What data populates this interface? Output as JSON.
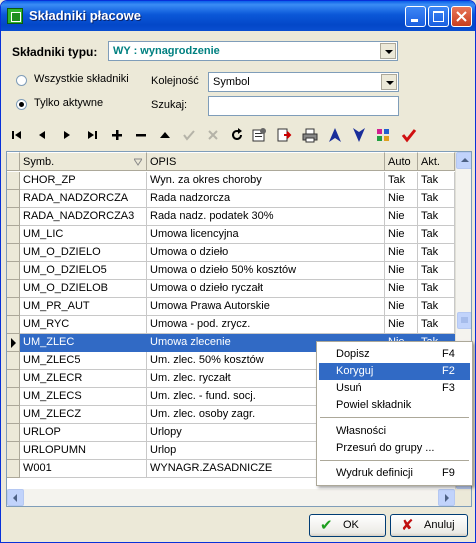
{
  "window": {
    "title": "Składniki płacowe"
  },
  "filters": {
    "type_label": "Składniki typu:",
    "type_value": "WY : wynagrodzenie",
    "radio_all": "Wszystkie składniki",
    "radio_active": "Tylko aktywne",
    "radio_selected": "active",
    "order_label": "Kolejność",
    "order_value": "Symbol",
    "search_label": "Szukaj:",
    "search_value": ""
  },
  "toolbar": {
    "icons": [
      "first-record-icon",
      "prev-record-icon",
      "next-record-icon",
      "last-record-icon",
      "add-icon",
      "delete-icon",
      "edit-icon",
      "confirm-icon",
      "cancel-icon",
      "refresh-icon",
      "properties-icon",
      "export-icon",
      "print-icon",
      "sort-asc-icon",
      "sort-desc-icon",
      "tools-icon",
      "check-icon"
    ]
  },
  "grid": {
    "columns": [
      "Symb.",
      "OPIS",
      "Auto",
      "Akt."
    ],
    "selected_row": 10,
    "rows": [
      [
        "CHOR_ZP",
        "Wyn. za okres choroby",
        "Tak",
        "Tak"
      ],
      [
        "RADA_NADZORCZA",
        "Rada nadzorcza",
        "Nie",
        "Tak"
      ],
      [
        "RADA_NADZORCZA3",
        "Rada nadz. podatek 30%",
        "Nie",
        "Tak"
      ],
      [
        "UM_LIC",
        "Umowa licencyjna",
        "Nie",
        "Tak"
      ],
      [
        "UM_O_DZIELO",
        "Umowa o dzieło",
        "Nie",
        "Tak"
      ],
      [
        "UM_O_DZIELO5",
        "Umowa o dzieło 50% kosztów",
        "Nie",
        "Tak"
      ],
      [
        "UM_O_DZIELOB",
        "Umowa o dzieło ryczałt",
        "Nie",
        "Tak"
      ],
      [
        "UM_PR_AUT",
        "Umowa Prawa Autorskie",
        "Nie",
        "Tak"
      ],
      [
        "UM_RYC",
        "Umowa - pod. zrycz.",
        "Nie",
        "Tak"
      ],
      [
        "UM_ZLEC",
        "Umowa zlecenie",
        "Nie",
        "Tak"
      ],
      [
        "UM_ZLEC5",
        "Um. zlec. 50% kosztów",
        "",
        ""
      ],
      [
        "UM_ZLECR",
        " Um. zlec. ryczałt",
        "",
        ""
      ],
      [
        "UM_ZLECS",
        " Um. zlec. - fund. socj.",
        "",
        ""
      ],
      [
        "UM_ZLECZ",
        " Um. zlec. osoby zagr.",
        "",
        ""
      ],
      [
        "URLOP",
        "Urlopy",
        "",
        ""
      ],
      [
        "URLOPUMN",
        "Urlop",
        "",
        ""
      ],
      [
        "W001",
        "WYNAGR.ZASADNICZE",
        "",
        ""
      ]
    ]
  },
  "context_menu": {
    "items": [
      {
        "label": "Dopisz",
        "key": "F4"
      },
      {
        "label": "Koryguj",
        "key": "F2"
      },
      {
        "label": "Usuń",
        "key": "F3"
      },
      {
        "label": "Powiel składnik",
        "key": ""
      },
      {
        "label": "Własności",
        "key": ""
      },
      {
        "label": "Przesuń do grupy ...",
        "key": ""
      },
      {
        "label": "Wydruk definicji",
        "key": "F9"
      }
    ],
    "highlighted": 1
  },
  "buttons": {
    "ok": "OK",
    "cancel": "Anuluj"
  },
  "colors": {
    "selection": "#316AC5",
    "title_bar": "#0A5FE8",
    "type_value_text": "#008080"
  }
}
